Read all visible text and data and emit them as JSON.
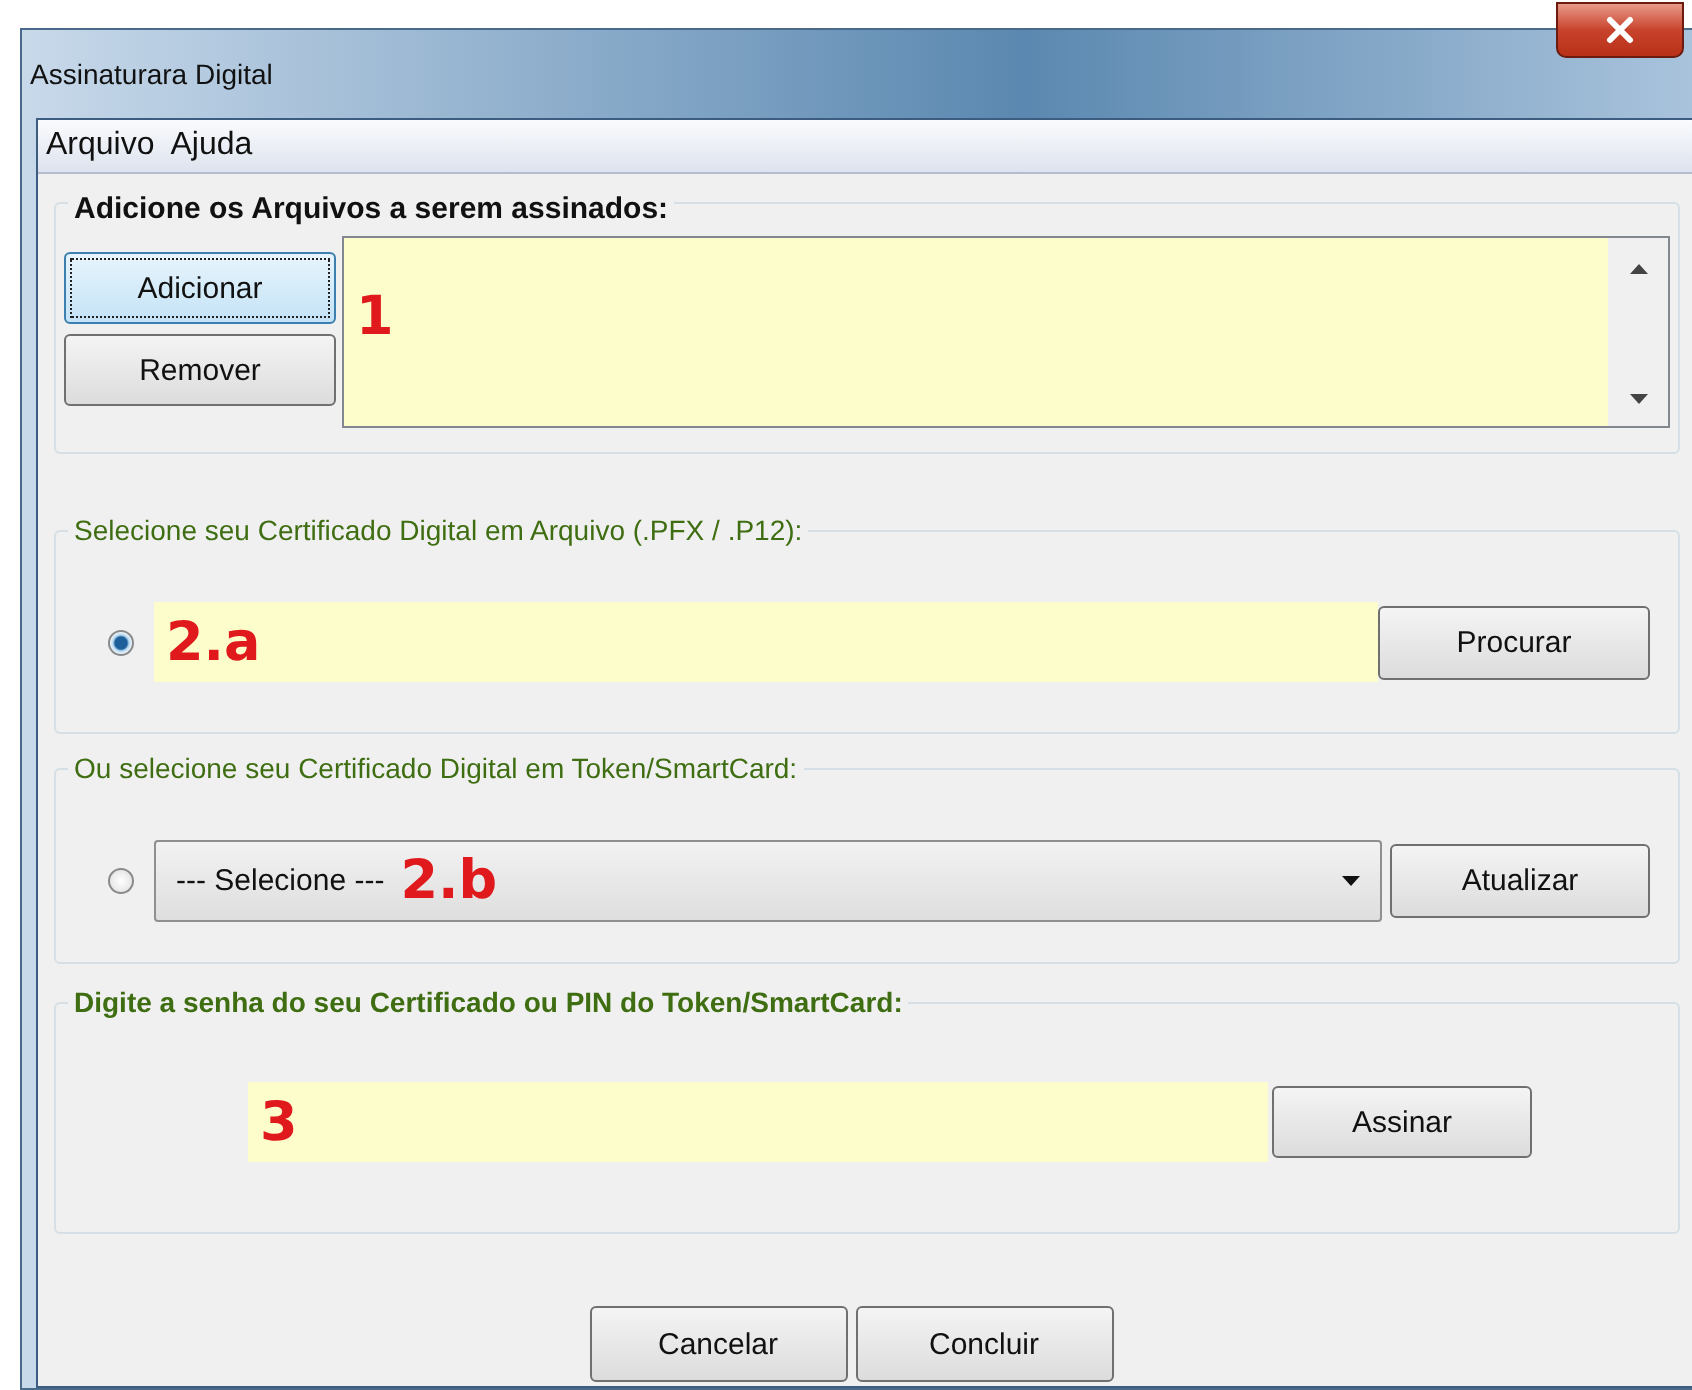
{
  "window": {
    "title": "Assinaturara Digital"
  },
  "menu": [
    {
      "label": "Arquivo"
    },
    {
      "label": "Ajuda"
    }
  ],
  "files_group": {
    "title": "Adicione os Arquivos a serem assinados:",
    "buttons": [
      {
        "label": "Adicionar",
        "focused": true
      },
      {
        "label": "Remover",
        "focused": false
      }
    ],
    "marker": "1"
  },
  "file_group": {
    "title": "Selecione seu Certificado Digital em Arquivo (.PFX / .P12):",
    "selected": true,
    "marker": "2.a",
    "button": "Procurar"
  },
  "token_group": {
    "title": "Ou selecione seu Certificado Digital em Token/SmartCard:",
    "selected": false,
    "value": "--- Selecione ---",
    "marker": "2.b",
    "button": "Atualizar"
  },
  "password_group": {
    "title": "Digite a senha do seu Certificado ou PIN do Token/SmartCard:",
    "marker": "3",
    "button": "Assinar"
  },
  "footer_buttons": [
    {
      "label": "Cancelar"
    },
    {
      "label": "Concluir"
    }
  ]
}
